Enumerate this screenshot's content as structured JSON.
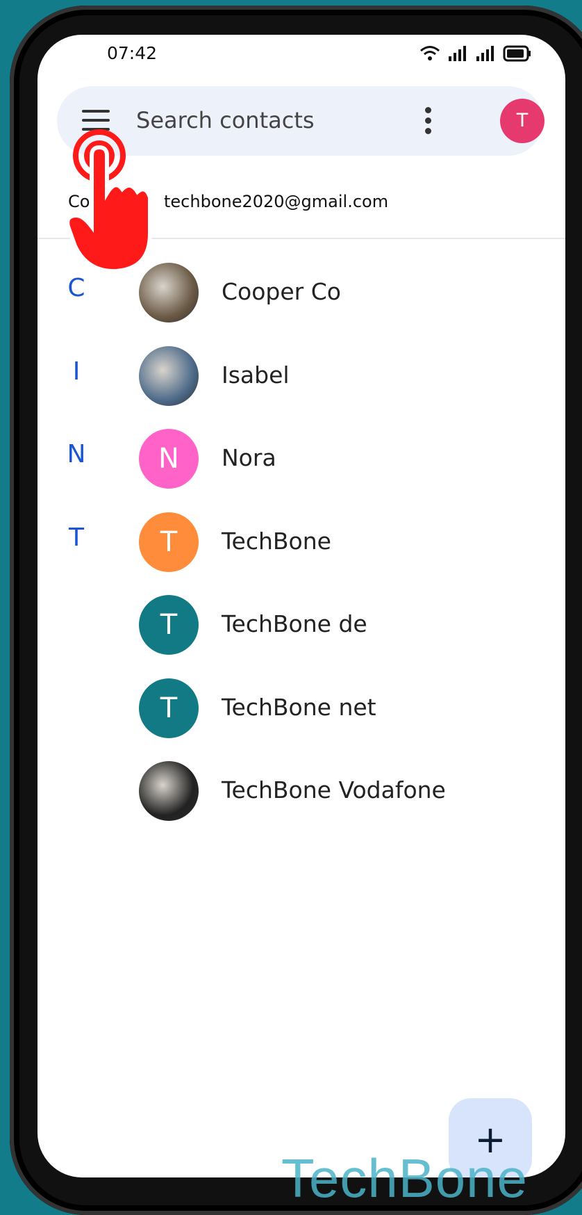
{
  "status_bar": {
    "time": "07:42"
  },
  "search": {
    "placeholder": "Search contacts",
    "account_initial": "T"
  },
  "account": {
    "label": "Co",
    "email": "techbone2020@gmail.com"
  },
  "contacts": [
    {
      "section": "C",
      "name": "Cooper Co",
      "avatar": "",
      "avatar_color": "#6b5a45",
      "photo": true
    },
    {
      "section": "I",
      "name": "Isabel",
      "avatar": "",
      "avatar_color": "#4e6b8a",
      "photo": true
    },
    {
      "section": "N",
      "name": "Nora",
      "avatar": "N",
      "avatar_color": "#ff63c7"
    },
    {
      "section": "T",
      "name": "TechBone",
      "avatar": "T",
      "avatar_color": "#ff8c3a"
    },
    {
      "section": "",
      "name": "TechBone de",
      "avatar": "T",
      "avatar_color": "#127a84"
    },
    {
      "section": "",
      "name": "TechBone net",
      "avatar": "T",
      "avatar_color": "#127a84"
    },
    {
      "section": "",
      "name": "TechBone Vodafone",
      "avatar": "",
      "avatar_color": "#222222",
      "photo": true
    }
  ],
  "fab": {
    "icon": "+"
  },
  "watermark": "TechBone",
  "colors": {
    "accent": "#1a56d0",
    "background": "#137c8b",
    "search_bg": "#edf2fa",
    "tap_indicator": "#ff1a1a"
  }
}
